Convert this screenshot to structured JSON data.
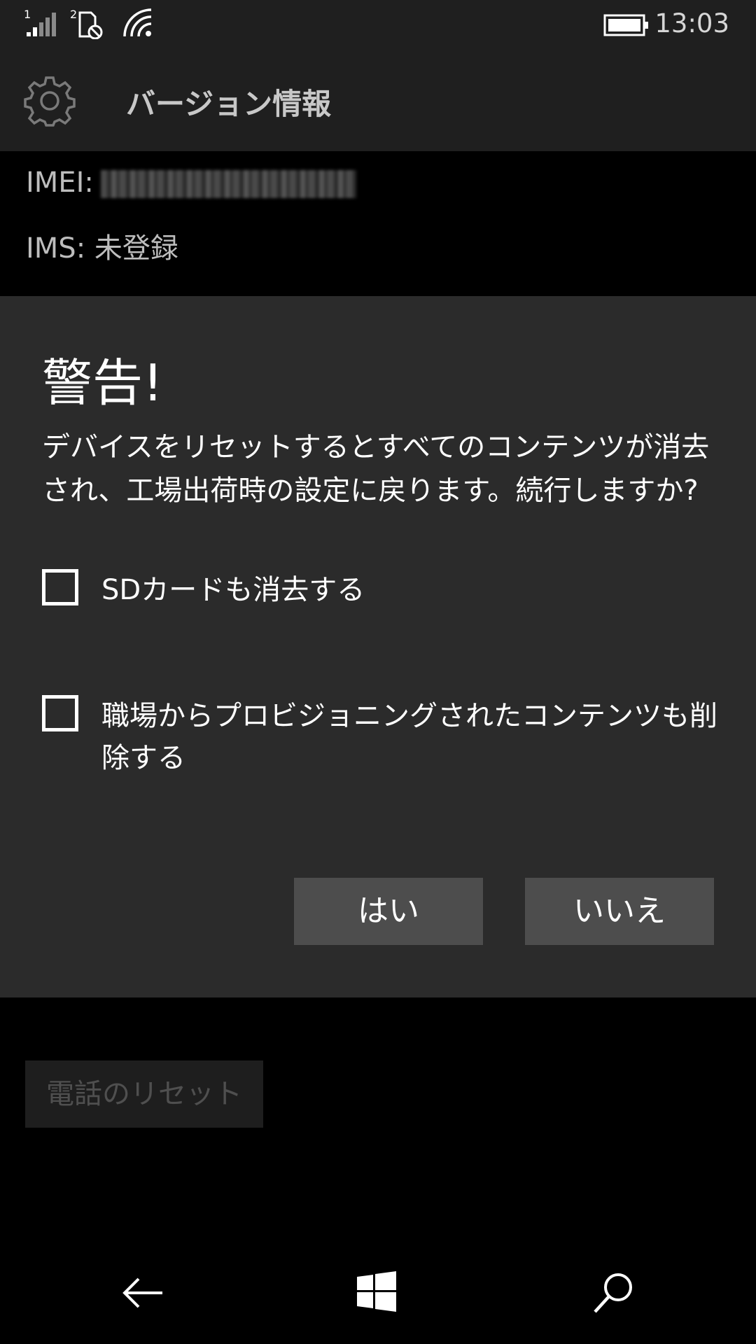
{
  "status_bar": {
    "sim1_label": "1",
    "sim2_label": "2",
    "time": "13:03"
  },
  "header": {
    "title": "バージョン情報"
  },
  "info": {
    "imei_label": "IMEI:",
    "ims_label": "IMS:",
    "ims_value": "未登録"
  },
  "dialog": {
    "title": "警告!",
    "message": "デバイスをリセットするとすべてのコンテンツが消去され、工場出荷時の設定に戻ります。続行しますか?",
    "checkboxes": [
      {
        "label": "SDカードも消去する",
        "checked": false
      },
      {
        "label": "職場からプロビジョニングされたコンテンツも削除する",
        "checked": false
      }
    ],
    "yes_label": "はい",
    "no_label": "いいえ"
  },
  "reset_button": {
    "label": "電話のリセット"
  },
  "icons": {
    "status": [
      "signal-icon",
      "sim-no-service-icon",
      "wifi-icon",
      "battery-icon"
    ],
    "nav": [
      "back-icon",
      "windows-start-icon",
      "search-icon"
    ]
  },
  "colors": {
    "background": "#000000",
    "header_bg": "#1f1f1f",
    "dialog_bg": "#2b2b2b",
    "button_bg": "#4d4d4d",
    "disabled_text": "#4f4f4f"
  }
}
